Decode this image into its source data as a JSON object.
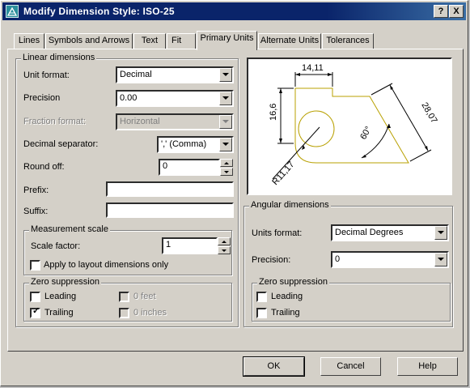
{
  "window": {
    "title": "Modify Dimension Style: ISO-25",
    "help_button": "?",
    "close_button": "X",
    "icon": "dimension-style-icon"
  },
  "tabs": [
    {
      "label": "Lines"
    },
    {
      "label": "Symbols and Arrows"
    },
    {
      "label": "Text"
    },
    {
      "label": "Fit"
    },
    {
      "label": "Primary Units"
    },
    {
      "label": "Alternate Units"
    },
    {
      "label": "Tolerances"
    }
  ],
  "active_tab": "Primary Units",
  "linear": {
    "legend": "Linear dimensions",
    "unit_format": {
      "label": "Unit format:",
      "value": "Decimal"
    },
    "precision": {
      "label": "Precision",
      "value": "0.00"
    },
    "fraction_format": {
      "label": "Fraction format:",
      "value": "Horizontal",
      "disabled": true
    },
    "decimal_separator": {
      "label": "Decimal separator:",
      "value": "',' (Comma)"
    },
    "round_off": {
      "label": "Round off:",
      "value": "0"
    },
    "prefix": {
      "label": "Prefix:",
      "value": ""
    },
    "suffix": {
      "label": "Suffix:",
      "value": ""
    }
  },
  "measurement_scale": {
    "legend": "Measurement scale",
    "scale_factor": {
      "label": "Scale factor:",
      "value": "1"
    },
    "apply_layout": {
      "label": "Apply to layout dimensions only",
      "checked": false
    }
  },
  "zero_suppression_linear": {
    "legend": "Zero suppression",
    "leading": {
      "label": "Leading",
      "checked": false
    },
    "trailing": {
      "label": "Trailing",
      "checked": true
    },
    "feet": {
      "label": "0 feet",
      "checked": false,
      "disabled": true
    },
    "inches": {
      "label": "0 inches",
      "checked": false,
      "disabled": true
    }
  },
  "preview": {
    "dim_top": "14,11",
    "dim_left": "16,6",
    "dim_right": "28,07",
    "dim_angle": "60°",
    "dim_radius": "R11,17"
  },
  "angular": {
    "legend": "Angular dimensions",
    "units_format": {
      "label": "Units format:",
      "value": "Decimal Degrees"
    },
    "precision": {
      "label": "Precision:",
      "value": "0"
    }
  },
  "zero_suppression_angular": {
    "legend": "Zero suppression",
    "leading": {
      "label": "Leading",
      "checked": false
    },
    "trailing": {
      "label": "Trailing",
      "checked": false
    }
  },
  "buttons": {
    "ok": "OK",
    "cancel": "Cancel",
    "help": "Help"
  },
  "colors": {
    "title_bar": "#0a246a",
    "face": "#d4d0c8",
    "preview_geometry": "#b8a000"
  }
}
